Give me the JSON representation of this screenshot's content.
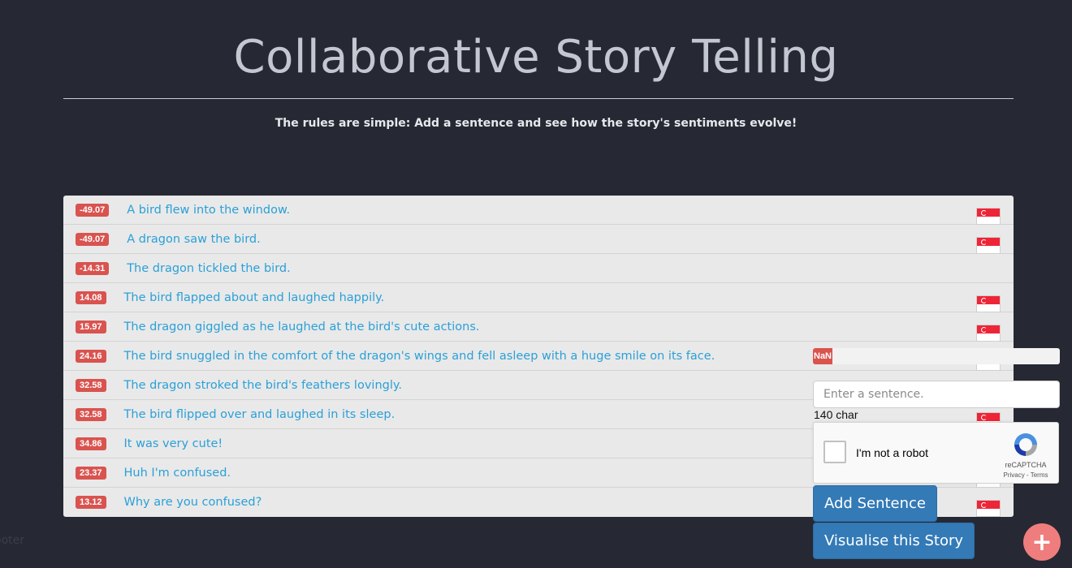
{
  "header": {
    "title": "Collaborative Story Telling",
    "subtitle": "The rules are simple: Add a sentence and see how the story's sentiments evolve!"
  },
  "story": {
    "rows": [
      {
        "score": "-49.07",
        "text": "A bird flew into the window.",
        "flag": true
      },
      {
        "score": "-49.07",
        "text": "A dragon saw the bird.",
        "flag": true
      },
      {
        "score": "-14.31",
        "text": "The dragon tickled the bird.",
        "flag": false
      },
      {
        "score": "14.08",
        "text": "The bird flapped about and laughed happily.",
        "flag": true
      },
      {
        "score": "15.97",
        "text": "The dragon giggled as he laughed at the bird's cute actions.",
        "flag": true
      },
      {
        "score": "24.16",
        "text": "The bird snuggled in the comfort of the dragon's wings and fell asleep with a huge smile on its face.",
        "flag": true
      },
      {
        "score": "32.58",
        "text": "The dragon stroked the bird's feathers lovingly.",
        "flag": true
      },
      {
        "score": "32.58",
        "text": "The bird flipped over and laughed in its sleep.",
        "flag": true
      },
      {
        "score": "34.86",
        "text": "It was very cute!",
        "flag": true
      },
      {
        "score": "23.37",
        "text": "Huh I'm confused.",
        "flag": true
      },
      {
        "score": "13.12",
        "text": "Why are you confused?",
        "flag": true
      }
    ],
    "flag_icon": "singapore-flag-icon",
    "badge_color": "#d9534f",
    "link_color": "#2aa0d8"
  },
  "sentiment_bar": {
    "label": "NaN"
  },
  "form": {
    "input_placeholder": "Enter a sentence.",
    "input_value": "",
    "char_count": "140 char",
    "captcha_label": "I'm not a robot",
    "captcha_brand": "reCAPTCHA",
    "captcha_terms": "Privacy - Terms",
    "add_button": "Add Sentence",
    "visualise_button": "Visualise this Story"
  },
  "fab": {
    "icon": "plus-icon",
    "label": "+"
  },
  "footer": {
    "text": "ooter"
  }
}
